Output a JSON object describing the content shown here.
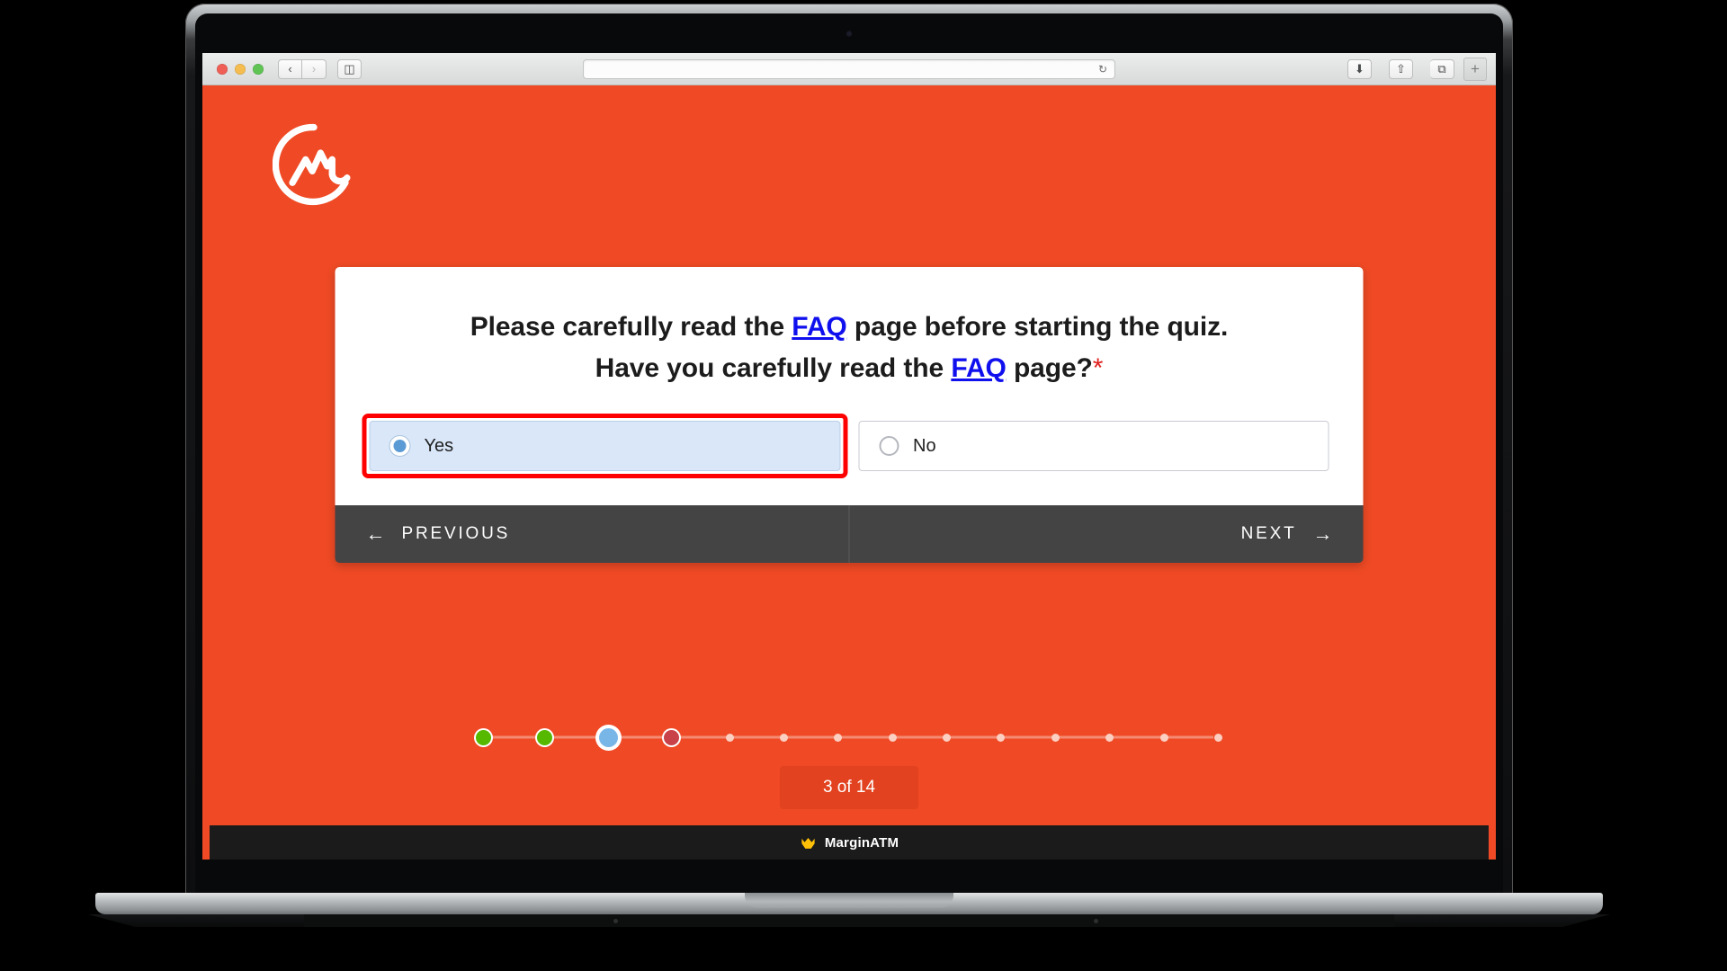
{
  "browser": {
    "traffic_lights": [
      "close",
      "minimize",
      "maximize"
    ],
    "back_label": "‹",
    "forward_label": "›",
    "sidebar_label": "◫",
    "url_value": "",
    "url_placeholder": "",
    "reload_label": "↻",
    "download_label": "⬇",
    "share_label": "⇧",
    "tabs_label": "⧉",
    "new_tab_label": "+"
  },
  "page": {
    "background_color": "#EF4A25",
    "logo_name": "coinmarketcap-logo"
  },
  "quiz": {
    "question": {
      "line1_prefix": "Please carefully read the ",
      "line1_link": "FAQ",
      "line1_suffix": " page before starting the quiz.",
      "line2_prefix": "Have you carefully read the ",
      "line2_link": "FAQ",
      "line2_suffix": " page?",
      "required_marker": "*"
    },
    "options": [
      {
        "label": "Yes",
        "selected": true,
        "highlighted": true
      },
      {
        "label": "No",
        "selected": false,
        "highlighted": false
      }
    ],
    "nav": {
      "previous_label": "PREVIOUS",
      "previous_arrow": "←",
      "next_label": "NEXT",
      "next_arrow": "→"
    }
  },
  "progress": {
    "counter_label": "3 of 14",
    "current_step": 3,
    "total_steps": 14,
    "steps": [
      {
        "state": "done"
      },
      {
        "state": "done"
      },
      {
        "state": "current"
      },
      {
        "state": "wrong"
      },
      {
        "state": "pending"
      },
      {
        "state": "pending"
      },
      {
        "state": "pending"
      },
      {
        "state": "pending"
      },
      {
        "state": "pending"
      },
      {
        "state": "pending"
      },
      {
        "state": "pending"
      },
      {
        "state": "pending"
      },
      {
        "state": "pending"
      },
      {
        "state": "pending"
      }
    ],
    "colors": {
      "done": "#57B800",
      "current": "#79B6E8",
      "wrong": "#C9424A",
      "pending": "#FBCFC2",
      "rail": "#F58A72"
    }
  },
  "brand": {
    "name": "MarginATM",
    "icon": "crown-icon",
    "icon_color": "#FFC107",
    "accent_color": "#EF4A25"
  }
}
